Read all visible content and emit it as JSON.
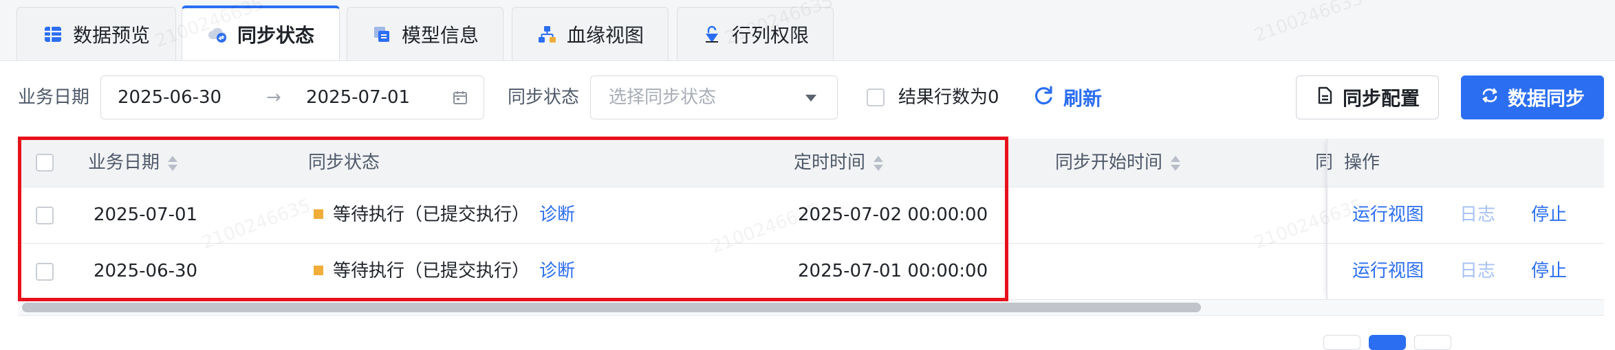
{
  "tabs": [
    {
      "label": "数据预览",
      "icon": "table-grid-icon"
    },
    {
      "label": "同步状态",
      "icon": "cloud-sync-icon",
      "active": true
    },
    {
      "label": "模型信息",
      "icon": "model-info-icon"
    },
    {
      "label": "血缘视图",
      "icon": "lineage-tree-icon"
    },
    {
      "label": "行列权限",
      "icon": "permission-lock-icon"
    }
  ],
  "filters": {
    "biz_date_label": "业务日期",
    "start_date": "2025-06-30",
    "end_date": "2025-07-01",
    "range_separator": "→",
    "sync_status_label": "同步状态",
    "sync_status_placeholder": "选择同步状态",
    "zero_rows_label": "结果行数为0",
    "refresh_label": "刷新",
    "sync_config_label": "同步配置",
    "data_sync_label": "数据同步"
  },
  "table": {
    "headers": {
      "biz_date": "业务日期",
      "sync_status": "同步状态",
      "scheduled_time": "定时时间",
      "sync_start_time": "同步开始时间",
      "truncated": "同",
      "actions": "操作"
    },
    "rows": [
      {
        "biz_date": "2025-07-01",
        "status": "等待执行（已提交执行）",
        "diagnose": "诊断",
        "scheduled_time": "2025-07-02 00:00:00",
        "actions": [
          "运行视图",
          "日志",
          "停止"
        ]
      },
      {
        "biz_date": "2025-06-30",
        "status": "等待执行（已提交执行）",
        "diagnose": "诊断",
        "scheduled_time": "2025-07-01 00:00:00",
        "actions": [
          "运行视图",
          "日志",
          "停止"
        ]
      }
    ]
  },
  "watermark": "2100246635",
  "colors": {
    "primary": "#2b6ef2",
    "status_waiting": "#f0ad3a",
    "highlight": "#e8101a"
  }
}
